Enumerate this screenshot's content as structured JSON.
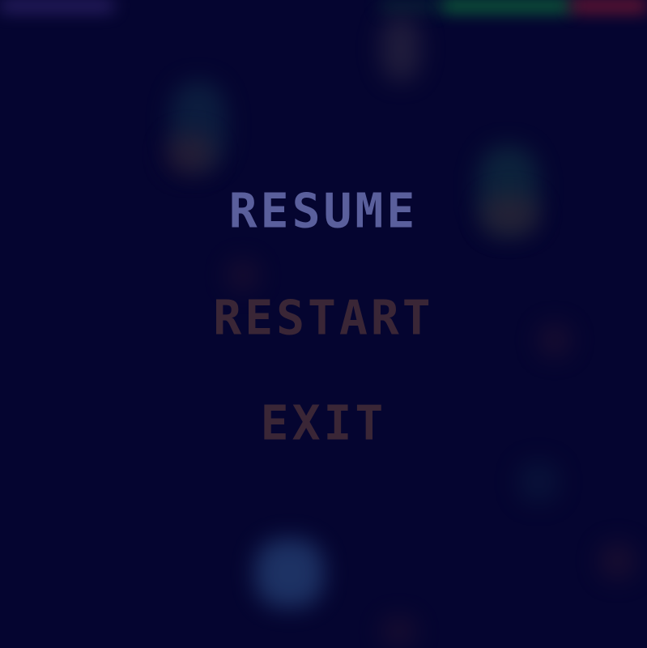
{
  "pause_menu": {
    "items": [
      {
        "label": "RESUME",
        "selected": true
      },
      {
        "label": "RESTART",
        "selected": false
      },
      {
        "label": "EXIT",
        "selected": false
      }
    ]
  },
  "hud": {
    "health_fraction": 0.63
  },
  "colors": {
    "background": "#050530",
    "selected_item": "#5a5f9c",
    "unselected_item": "#3a2636",
    "health_green": "#0f7a3c",
    "health_red": "#8a1c33"
  }
}
